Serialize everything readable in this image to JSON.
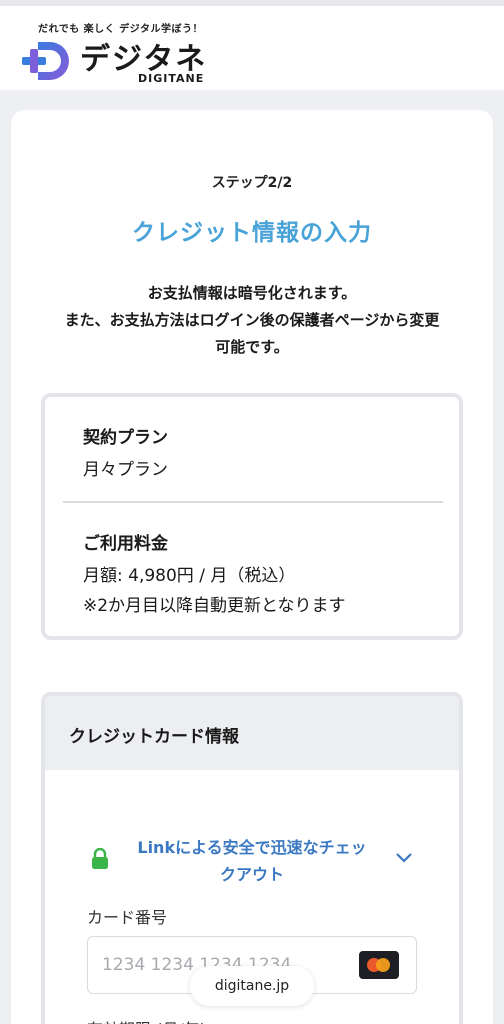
{
  "header": {
    "tagline": "だれでも 楽しく デジタル学ぼう！",
    "logo_name": "デジタネ",
    "logo_sub": "DIGITANE"
  },
  "step": "ステップ2/2",
  "title": "クレジット情報の入力",
  "description": {
    "line1": "お支払情報は暗号化されます。",
    "line2": "また、お支払方法はログイン後の保護者ページから変更",
    "line3": "可能です。"
  },
  "plan": {
    "contract_label": "契約プラン",
    "contract_value": "月々プラン",
    "fee_label": "ご利用料金",
    "fee_value": "月額: 4,980円 / 月（税込）",
    "fee_note": "※2か月目以降自動更新となります"
  },
  "credit_card": {
    "section_title": "クレジットカード情報",
    "link_line1": "Linkによる安全で迅速なチェッ",
    "link_line2": "クアウト",
    "card_number_label": "カード番号",
    "card_number_placeholder": "1234 1234 1234 1234",
    "expiry_label": "有効期限 (月/年)"
  },
  "browser": {
    "url": "digitane.jp"
  },
  "colors": {
    "accent_title": "#4aa3d8",
    "link_blue": "#3b78c2",
    "lock_green": "#3bb54a",
    "logo_blue": "#3a7be0",
    "logo_purple": "#8a5ad8"
  }
}
